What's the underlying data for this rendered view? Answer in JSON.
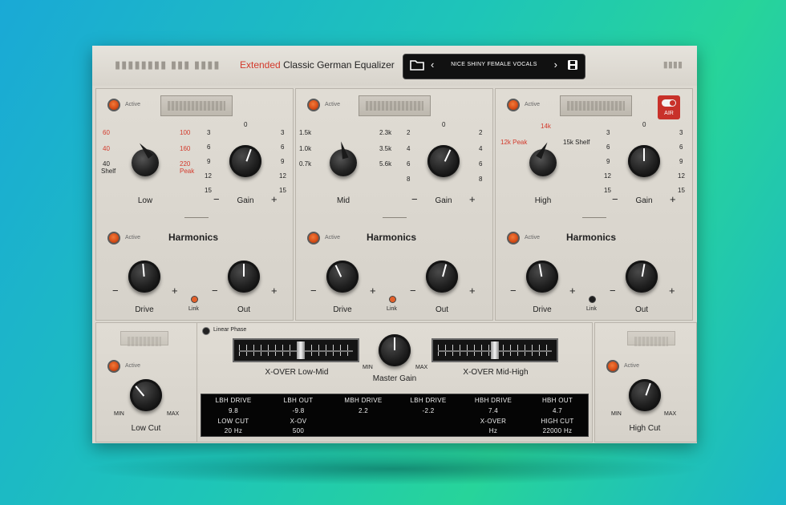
{
  "header": {
    "title_accent": "Extended",
    "title_rest": "Classic German Equalizer",
    "preset_name": "NICE SHINY FEMALE VOCALS",
    "folder_icon": "folder-icon",
    "prev_icon": "chevron-left-icon",
    "next_icon": "chevron-right-icon",
    "save_icon": "save-icon"
  },
  "colors": {
    "accent_red": "#d33a2c",
    "active_orange": "#e2602a",
    "panel": "#dcd8d0",
    "display_bg": "#050505"
  },
  "low_band": {
    "active_label": "Active",
    "freq_left": [
      "60",
      "40",
      "40"
    ],
    "freq_left_sub": "Shelf",
    "freq_right": [
      "100",
      "160",
      "220"
    ],
    "freq_right_sub": "Peak",
    "freq_label": "Low",
    "gain_left": [
      "3",
      "6",
      "9",
      "12",
      "15"
    ],
    "gain_right": [
      "3",
      "6",
      "9",
      "12",
      "15"
    ],
    "gain_top": "0",
    "gain_label": "Gain",
    "minus": "−",
    "plus": "+"
  },
  "mid_band": {
    "active_label": "Active",
    "freq_left": [
      "1.5k",
      "1.0k",
      "0.7k"
    ],
    "freq_right": [
      "2.3k",
      "3.5k",
      "5.6k"
    ],
    "freq_label": "Mid",
    "gain_left": [
      "2",
      "4",
      "6",
      "8"
    ],
    "gain_right": [
      "2",
      "4",
      "6",
      "8"
    ],
    "gain_top": "0",
    "gain_label": "Gain",
    "minus": "−",
    "plus": "+"
  },
  "high_band": {
    "active_label": "Active",
    "freq_top": "14k",
    "freq_left": "12k Peak",
    "freq_right": "15k Shelf",
    "freq_label": "High",
    "air_label": "AIR",
    "gain_left": [
      "3",
      "6",
      "9",
      "12",
      "15"
    ],
    "gain_right": [
      "3",
      "6",
      "9",
      "12",
      "15"
    ],
    "gain_top": "0",
    "gain_label": "Gain",
    "minus": "−",
    "plus": "+"
  },
  "harmonics": {
    "title": "Harmonics",
    "active_label": "Active",
    "drive_label": "Drive",
    "out_label": "Out",
    "link_label": "Link",
    "minus": "−",
    "plus": "+"
  },
  "low_cut": {
    "active_label": "Active",
    "min": "MIN",
    "max": "MAX",
    "label": "Low Cut"
  },
  "high_cut": {
    "active_label": "Active",
    "min": "MIN",
    "max": "MAX",
    "label": "High Cut"
  },
  "center": {
    "linear_phase": "Linear Phase",
    "xover_low_mid": "X-OVER Low-Mid",
    "xover_mid_high": "X-OVER Mid-High",
    "master_gain": "Master Gain",
    "min": "MIN",
    "max": "MAX"
  },
  "display": {
    "row1_labels": [
      "LBH DRIVE",
      "LBH OUT",
      "MBH DRIVE",
      "LBH DRIVE",
      "HBH DRIVE",
      "HBH OUT"
    ],
    "row1_values": [
      "9.8",
      "-9.8",
      "2.2",
      "-2.2",
      "7.4",
      "4.7"
    ],
    "row2_labels": [
      "LOW CUT",
      "X-OV",
      "",
      "",
      "X-OVER",
      "HIGH CUT"
    ],
    "row2_values": [
      "20 Hz",
      "500",
      "",
      "",
      "Hz",
      "22000 Hz"
    ]
  }
}
